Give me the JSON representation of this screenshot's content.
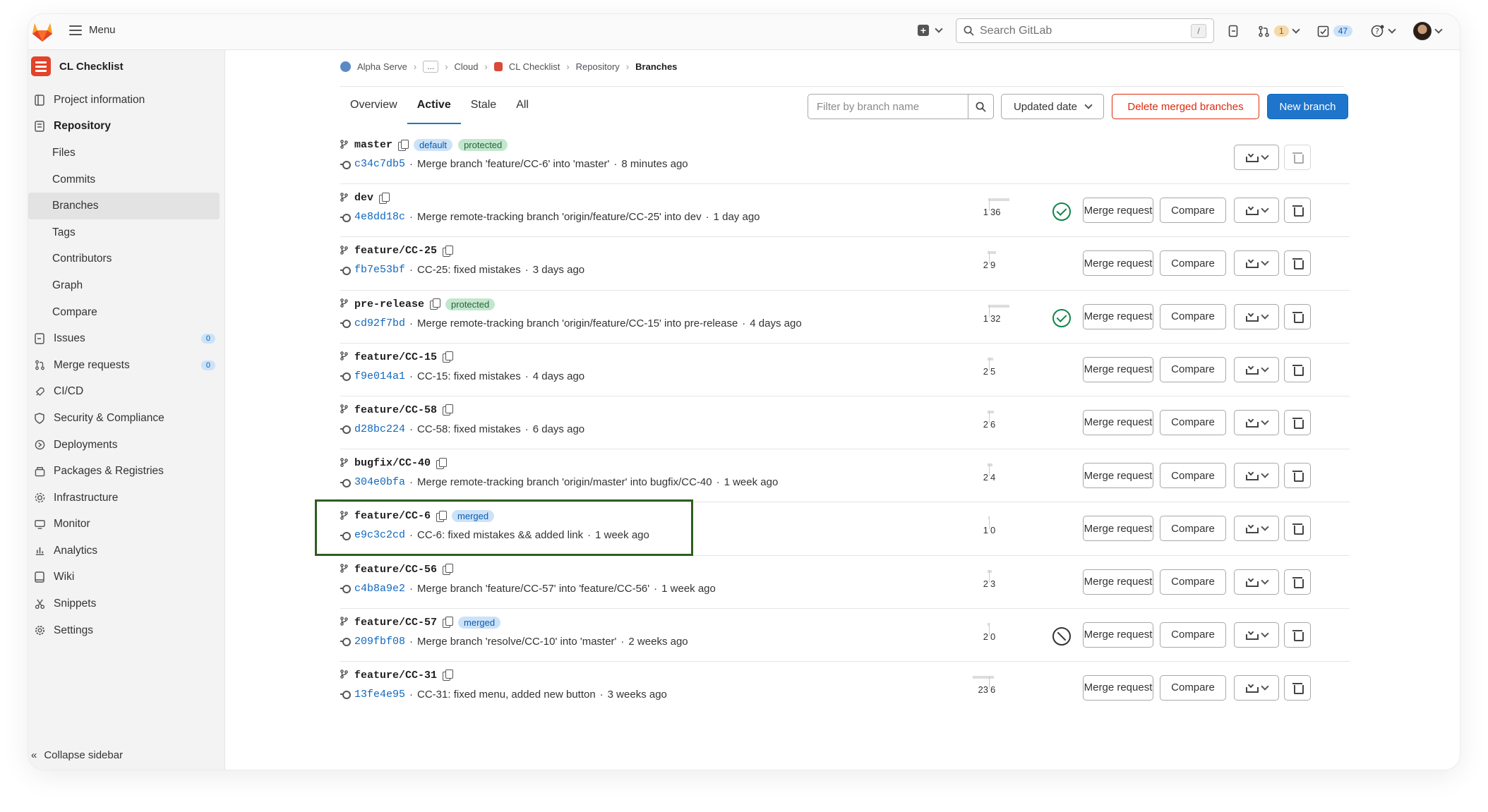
{
  "topbar": {
    "menu_label": "Menu",
    "search_placeholder": "Search GitLab",
    "search_shortcut": "/",
    "mr_count": "1",
    "todo_count": "47"
  },
  "sidebar": {
    "project_name": "CL Checklist",
    "items": [
      {
        "label": "Project information",
        "icon": "info-icon",
        "type": "top"
      },
      {
        "label": "Repository",
        "icon": "book-icon",
        "type": "top-bold"
      },
      {
        "label": "Files",
        "type": "sub"
      },
      {
        "label": "Commits",
        "type": "sub"
      },
      {
        "label": "Branches",
        "type": "sub-active"
      },
      {
        "label": "Tags",
        "type": "sub"
      },
      {
        "label": "Contributors",
        "type": "sub"
      },
      {
        "label": "Graph",
        "type": "sub"
      },
      {
        "label": "Compare",
        "type": "sub"
      },
      {
        "label": "Issues",
        "icon": "issues-icon",
        "type": "top",
        "badge": "0"
      },
      {
        "label": "Merge requests",
        "icon": "merge-request-icon",
        "type": "top",
        "badge": "0"
      },
      {
        "label": "CI/CD",
        "icon": "rocket-icon",
        "type": "top"
      },
      {
        "label": "Security & Compliance",
        "icon": "shield-icon",
        "type": "top"
      },
      {
        "label": "Deployments",
        "icon": "deployments-icon",
        "type": "top"
      },
      {
        "label": "Packages & Registries",
        "icon": "package-icon",
        "type": "top"
      },
      {
        "label": "Infrastructure",
        "icon": "cloud-gear-icon",
        "type": "top"
      },
      {
        "label": "Monitor",
        "icon": "monitor-icon",
        "type": "top"
      },
      {
        "label": "Analytics",
        "icon": "chart-icon",
        "type": "top"
      },
      {
        "label": "Wiki",
        "icon": "wiki-icon",
        "type": "top"
      },
      {
        "label": "Snippets",
        "icon": "scissors-icon",
        "type": "top"
      },
      {
        "label": "Settings",
        "icon": "settings-icon",
        "type": "top"
      }
    ],
    "collapse_label": "Collapse sidebar"
  },
  "breadcrumbs": [
    "Alpha Serve",
    "...",
    "Cloud",
    "CL Checklist",
    "Repository",
    "Branches"
  ],
  "tabs": [
    "Overview",
    "Active",
    "Stale",
    "All"
  ],
  "active_tab": "Active",
  "toolbar": {
    "filter_placeholder": "Filter by branch name",
    "sort_label": "Updated date",
    "delete_merged_label": "Delete merged branches",
    "new_branch_label": "New branch"
  },
  "row_buttons": {
    "merge_request": "Merge request",
    "compare": "Compare"
  },
  "branches": [
    {
      "name": "master",
      "badges": [
        "default",
        "protected"
      ],
      "sha": "c34c7db5",
      "message": "Merge branch 'feature/CC-6' into 'master'",
      "time": "8 minutes ago",
      "behind": "",
      "ahead": "",
      "status": "",
      "show_actions": false
    },
    {
      "name": "dev",
      "badges": [],
      "sha": "4e8dd18c",
      "message": "Merge remote-tracking branch 'origin/feature/CC-25' into dev",
      "time": "1 day ago",
      "behind": "1",
      "ahead": "36",
      "status": "passed",
      "show_actions": true
    },
    {
      "name": "feature/CC-25",
      "badges": [],
      "sha": "fb7e53bf",
      "message": "CC-25: fixed mistakes",
      "time": "3 days ago",
      "behind": "2",
      "ahead": "9",
      "status": "",
      "show_actions": true
    },
    {
      "name": "pre-release",
      "badges": [
        "protected"
      ],
      "sha": "cd92f7bd",
      "message": "Merge remote-tracking branch 'origin/feature/CC-15' into pre-release",
      "time": "4 days ago",
      "behind": "1",
      "ahead": "32",
      "status": "passed",
      "show_actions": true
    },
    {
      "name": "feature/CC-15",
      "badges": [],
      "sha": "f9e014a1",
      "message": "CC-15: fixed mistakes",
      "time": "4 days ago",
      "behind": "2",
      "ahead": "5",
      "status": "",
      "show_actions": true
    },
    {
      "name": "feature/CC-58",
      "badges": [],
      "sha": "d28bc224",
      "message": "CC-58: fixed mistakes",
      "time": "6 days ago",
      "behind": "2",
      "ahead": "6",
      "status": "",
      "show_actions": true
    },
    {
      "name": "bugfix/CC-40",
      "badges": [],
      "sha": "304e0bfa",
      "message": "Merge remote-tracking branch 'origin/master' into bugfix/CC-40",
      "time": "1 week ago",
      "behind": "2",
      "ahead": "4",
      "status": "",
      "show_actions": true
    },
    {
      "name": "feature/CC-6",
      "badges": [
        "merged"
      ],
      "sha": "e9c3c2cd",
      "message": "CC-6: fixed mistakes && added link",
      "time": "1 week ago",
      "behind": "1",
      "ahead": "0",
      "status": "",
      "show_actions": true
    },
    {
      "name": "feature/CC-56",
      "badges": [],
      "sha": "c4b8a9e2",
      "message": "Merge branch 'feature/CC-57' into 'feature/CC-56'",
      "time": "1 week ago",
      "behind": "2",
      "ahead": "3",
      "status": "",
      "show_actions": true
    },
    {
      "name": "feature/CC-57",
      "badges": [
        "merged"
      ],
      "sha": "209fbf08",
      "message": "Merge branch 'resolve/CC-10' into 'master'",
      "time": "2 weeks ago",
      "behind": "2",
      "ahead": "0",
      "status": "skipped",
      "show_actions": true
    },
    {
      "name": "feature/CC-31",
      "badges": [],
      "sha": "13fe4e95",
      "message": "CC-31: fixed menu, added new button",
      "time": "3 weeks ago",
      "behind": "23",
      "ahead": "6",
      "status": "",
      "show_actions": true
    }
  ],
  "colors": {
    "accent": "#1f75cb",
    "danger": "#dd2b0e",
    "highlight": "#2e5e1f"
  }
}
